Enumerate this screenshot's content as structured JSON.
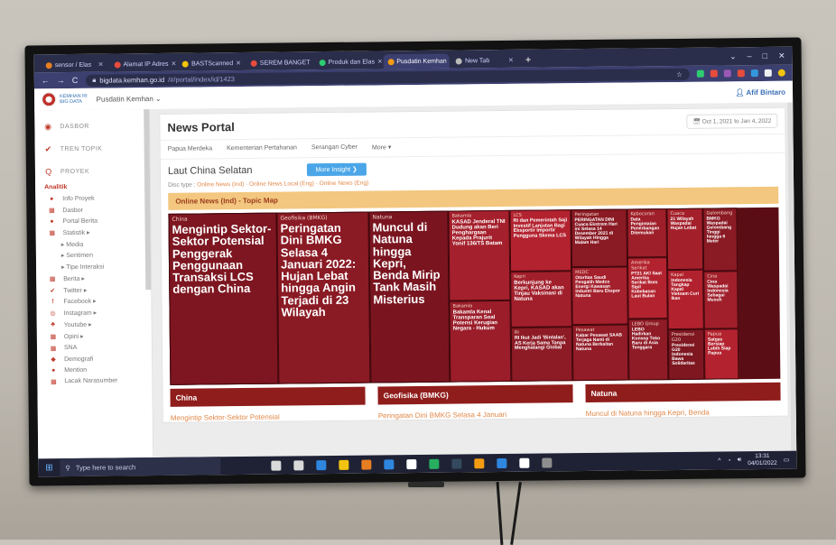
{
  "browser": {
    "tabs": [
      {
        "label": "sensor / Elas",
        "fav": "#e67e22"
      },
      {
        "label": "Alamat IP Adres",
        "fav": "#e74c3c"
      },
      {
        "label": "BASTScanned",
        "fav": "#f1c40f"
      },
      {
        "label": "SEREM BANGET",
        "fav": "#e74c3c"
      },
      {
        "label": "Produk dan Elas",
        "fav": "#2ecc71"
      },
      {
        "label": "Pusdatin Kemhan",
        "fav": "#f39c12"
      },
      {
        "label": "New Tab",
        "fav": "#bbbbbb"
      }
    ],
    "active_tab": 5,
    "url_host": "bigdata.kemhan.go.id",
    "url_path": "/#/portal/index/id/1423"
  },
  "header": {
    "logo_text": "KEMHAN RI",
    "logo_subtext": "BIG DATA",
    "menu_label": "Pusdatin Kemhan",
    "user_label": "Afif Bintaro"
  },
  "sidebar": {
    "main_items": [
      {
        "icon": "◉",
        "label": "DASBOR"
      },
      {
        "icon": "✔",
        "label": "TREN TOPIK"
      },
      {
        "icon": "Q",
        "label": "PROYEK"
      }
    ],
    "analytics_label": "Analitik",
    "items": [
      {
        "icon": "●",
        "label": "Info Proyek"
      },
      {
        "icon": "▦",
        "label": "Dasbor"
      },
      {
        "icon": "●",
        "label": "Portal Berita"
      },
      {
        "icon": "▦",
        "label": "Statistik ▸"
      }
    ],
    "subitems": [
      "▸  Media",
      "▸  Sentimen",
      "▸  Tipe Interaksi"
    ],
    "items2": [
      {
        "icon": "▦",
        "label": "Berita ▸"
      },
      {
        "icon": "✔",
        "label": "Twitter ▸"
      },
      {
        "icon": "f",
        "label": "Facebook ▸"
      },
      {
        "icon": "◎",
        "label": "Instagram ▸"
      },
      {
        "icon": "♣",
        "label": "Youtube ▸"
      },
      {
        "icon": "▦",
        "label": "Opini ▸"
      },
      {
        "icon": "▦",
        "label": "SNA"
      },
      {
        "icon": "◆",
        "label": "Demografi"
      },
      {
        "icon": "●",
        "label": "Mention"
      },
      {
        "icon": "▦",
        "label": "Lacak Narasumber"
      }
    ]
  },
  "portal": {
    "title": "News Portal",
    "date_range": "Oct 1, 2021 to Jan 4, 2022",
    "tabs": [
      "Papua Merdeka",
      "Kementerian Pertahanan",
      "Serangan Cyber",
      "More ▾"
    ],
    "section_title": "Laut China Selatan",
    "insight_button": "More Insight ❯",
    "disc_label": "Disc type : ",
    "disc_options": "Online News (Ind) · Online News Local (Eng) · Online News (Eng)",
    "banner": "Online News (Ind) - Topic Map",
    "tables": [
      {
        "header": "China",
        "first_row": "Mengintip Sektor-Sektor Potensial"
      },
      {
        "header": "Geofisika (BMKG)",
        "first_row": "Peringatan Dini BMKG Selasa 4 Januari"
      },
      {
        "header": "Natuna",
        "first_row": "Muncul di Natuna hingga Kepri, Benda"
      }
    ]
  },
  "treemap": [
    {
      "cat": "China",
      "title": "Mengintip Sektor-Sektor Potensial Penggerak Penggunaan Transaksi LCS dengan China",
      "color": "#7d1620",
      "fs": 13
    },
    {
      "cat": "Geofisika (BMKG)",
      "title": "Peringatan Dini BMKG Selasa 4 Januari 2022: Hujan Lebat hingga Angin Terjadi di 23 Wilayah",
      "color": "#8a1a24",
      "fs": 13
    },
    {
      "cat": "Natuna",
      "title": "Muncul di Natuna hingga Kepri, Benda Mirip Tank Masih Misterius",
      "color": "#7a1520",
      "fs": 13
    },
    {
      "cat": "Bakamla",
      "title": "KASAD Jenderal TNI Dudung akan Beri Penghargaan Kepada Prajurit Yonif 136/TS Batam",
      "color": "#a4202c",
      "fs": 6
    },
    {
      "cat": "Bakamla",
      "title": "Bakamla Kenal Transparan Soal Potensi Kerugian Negara - Hukum",
      "color": "#9a1d29",
      "fs": 6
    },
    {
      "cat": "LCS",
      "title": "RI dan Pemerintah Saji Investif Lanjutan Bagi Eksportir Importir Pengguna Skema LCS",
      "color": "#b3222f",
      "fs": 5.5
    },
    {
      "cat": "Kepri",
      "title": "Berkunjung ke Kepri, KASAD akan Tinjau Vaksinasi di Natuna",
      "color": "#a11f2b",
      "fs": 6
    },
    {
      "cat": "RI",
      "title": "RI Ikut Jadi 'Bintalan', AS Kerja Sama Tanpa Menghalangi Global",
      "color": "#8d1b25",
      "fs": 5.5
    },
    {
      "cat": "Peringatan",
      "title": "PERINGATAN DINI Cuaca Ekstrem Hari ini Selasa 14 Desember 2021 di Wilayah Hingga Malam Hari",
      "color": "#8a1a24",
      "fs": 5
    },
    {
      "cat": "MEDC",
      "title": "Otoritas Saudi Pengalih Medco Energi Kawasan Industri Baru Ekspor Natuna",
      "color": "#a4202c",
      "fs": 5
    },
    {
      "cat": "Pesawat",
      "title": "Kabar Pesawat SAAB Terjaga Nanti di Natuna Berkaitan Natuna",
      "color": "#921c27",
      "fs": 5
    },
    {
      "cat": "Kebocoran",
      "title": "Data Pengintaian Penerbangan Ditemukan",
      "color": "#9e1f2a",
      "fs": 5
    },
    {
      "cat": "Amerika Serikat",
      "title": "PT21 AKI Saat Amerika Serikat Bom Sipil Kebebasan Laut Bulan",
      "color": "#b2232f",
      "fs": 5
    },
    {
      "cat": "LEBO Group",
      "title": "LEBO Hadirkan Konsep Toko Baru di Asia Tenggara",
      "color": "#8e1b26",
      "fs": 5
    },
    {
      "cat": "Cuaca",
      "title": "21 Wilayah Waspadai Hujan Lebat",
      "color": "#a3202b",
      "fs": 5
    },
    {
      "cat": "Kapal",
      "title": "Indonesia Tangkap Kapal Vietnam Curi Ikan",
      "color": "#b1222e",
      "fs": 5
    },
    {
      "cat": "Presidensi G20",
      "title": "Presidensi G20 Indonesia Bawa Solidaritas",
      "color": "#7f1721",
      "fs": 5
    },
    {
      "cat": "Gelombang",
      "title": "BMKG Waspadai Gelombang Tinggi hingga 6 Meter",
      "color": "#8a1a24",
      "fs": 5
    },
    {
      "cat": "Cina",
      "title": "Cina Waspadai Indonesia Sebagai Musuh",
      "color": "#a01f2b",
      "fs": 5
    },
    {
      "cat": "Papua",
      "title": "Satgas Bersiap Lebih Siap Papua",
      "color": "#b3232f",
      "fs": 5
    }
  ],
  "taskbar": {
    "search_placeholder": "Type here to search",
    "time": "13:31",
    "date": "04/01/2022",
    "icons": [
      "#d9d9d9",
      "#d9d9d9",
      "#2e86de",
      "#f1c40f",
      "#e67e22",
      "#2e86de",
      "#ffffff",
      "#27ae60",
      "#34495e",
      "#f39c12",
      "#2e86de",
      "#ffffff",
      "#8e8e8e"
    ]
  }
}
